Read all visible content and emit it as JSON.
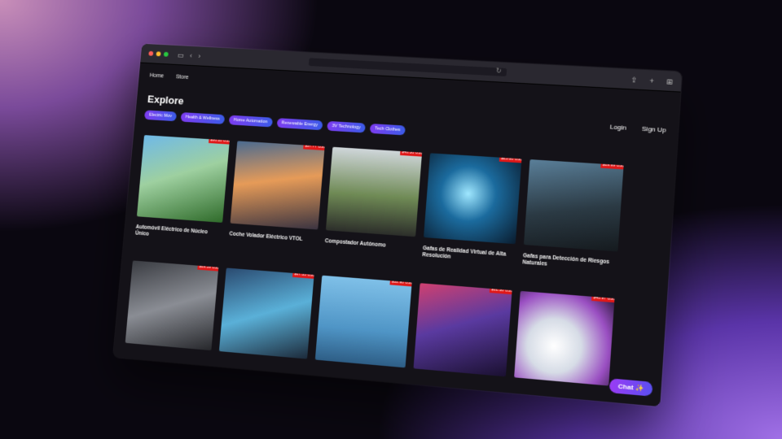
{
  "nav": {
    "items": [
      "Home",
      "Store"
    ]
  },
  "page": {
    "heading": "Explore"
  },
  "auth": {
    "login": "Login",
    "signup": "Sign Up"
  },
  "categories": [
    "Electric Mov",
    "Health & Wellness",
    "Home Automation",
    "Renewable Energy",
    "3V Technology",
    "Tech Clothes"
  ],
  "products": [
    {
      "title": "Automóvil Eléctrico de Núcleo Único",
      "price": "$36.18 USD"
    },
    {
      "title": "Coche Volador Eléctrico VTOL",
      "price": "$37.77 USD"
    },
    {
      "title": "Compostador Autónomo",
      "price": "$40.36 USD"
    },
    {
      "title": "Gafas de Realidad Virtual de Alta Resolución",
      "price": "$25.00 USD"
    },
    {
      "title": "Gafas para Detección de Riesgos Naturales",
      "price": "$19.99 USD"
    },
    {
      "title": "",
      "price": "$19.59 USD"
    },
    {
      "title": "",
      "price": "$17.33 USD"
    },
    {
      "title": "",
      "price": "$32.98 USD"
    },
    {
      "title": "",
      "price": "$31.38 USD"
    },
    {
      "title": "",
      "price": "$40.97 USD"
    }
  ],
  "chat": {
    "label": "Chat ✨"
  },
  "colors": {
    "accent": "#7d3cf0",
    "price_tag": "#e01818",
    "background": "#141218"
  }
}
